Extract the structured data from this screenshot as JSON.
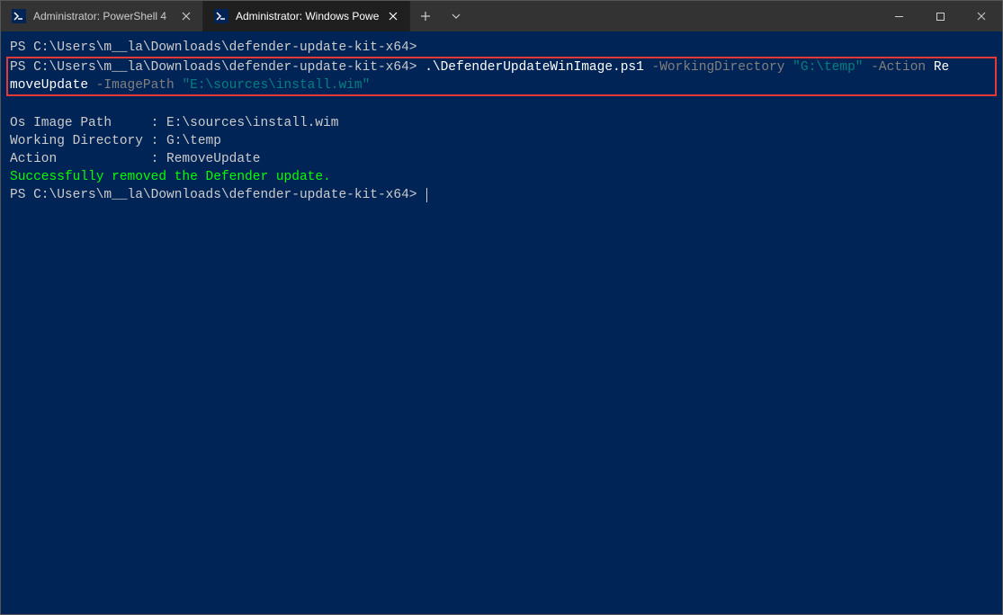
{
  "tabs": [
    {
      "label": "Administrator: PowerShell 4",
      "active": false
    },
    {
      "label": "Administrator: Windows PowerS",
      "active": true
    }
  ],
  "prompt1": "PS C:\\Users\\m__la\\Downloads\\defender-update-kit-x64>",
  "prompt2": "PS C:\\Users\\m__la\\Downloads\\defender-update-kit-x64>",
  "cmd": {
    "script": ".\\DefenderUpdateWinImage.ps1",
    "p1": "-WorkingDirectory",
    "v1": "\"G:\\temp\"",
    "p2": "-Action",
    "v2a": "Re",
    "v2b": "moveUpdate",
    "p3": "-ImagePath",
    "v3": "\"E:\\sources\\install.wim\""
  },
  "out": {
    "l1": "Os Image Path     : E:\\sources\\install.wim",
    "l2": "Working Directory : G:\\temp",
    "l3": "Action            : RemoveUpdate",
    "success": "Successfully removed the Defender update."
  },
  "prompt3": "PS C:\\Users\\m__la\\Downloads\\defender-update-kit-x64>"
}
